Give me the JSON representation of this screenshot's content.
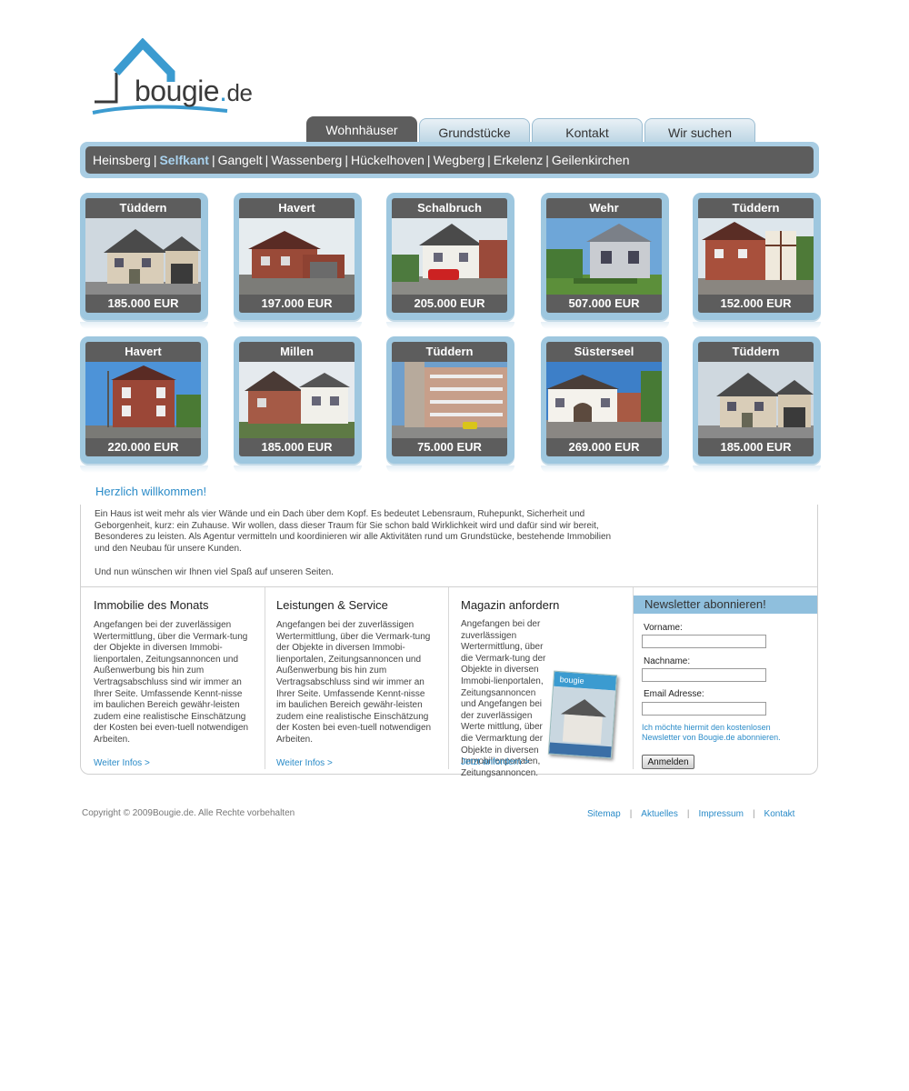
{
  "logo": {
    "brand": "bougie",
    "dot": ".",
    "tld": "de",
    "colors": {
      "roof": "#3b9bd0",
      "text": "#3a3a3a"
    }
  },
  "tabs": [
    {
      "label": "Wohnhäuser",
      "active": true
    },
    {
      "label": "Grundstücke",
      "active": false
    },
    {
      "label": "Kontakt",
      "active": false
    },
    {
      "label": "Wir suchen",
      "active": false
    }
  ],
  "cities": [
    {
      "label": "Heinsberg",
      "selected": false
    },
    {
      "label": "Selfkant",
      "selected": true
    },
    {
      "label": "Gangelt",
      "selected": false
    },
    {
      "label": "Wassenberg",
      "selected": false
    },
    {
      "label": "Hückelhoven",
      "selected": false
    },
    {
      "label": "Wegberg",
      "selected": false
    },
    {
      "label": "Erkelenz",
      "selected": false
    },
    {
      "label": "Geilenkirchen",
      "selected": false
    }
  ],
  "city_separator": "|",
  "properties": [
    {
      "title": "Tüddern",
      "price": "185.000 EUR",
      "photo": "house-gray-garage"
    },
    {
      "title": "Havert",
      "price": "197.000 EUR",
      "photo": "house-brick-garage"
    },
    {
      "title": "Schalbruch",
      "price": "205.000 EUR",
      "photo": "house-white-red-car"
    },
    {
      "title": "Wehr",
      "price": "507.000 EUR",
      "photo": "house-modern-gray"
    },
    {
      "title": "Tüddern",
      "price": "152.000 EUR",
      "photo": "house-brick-timber"
    },
    {
      "title": "Havert",
      "price": "220.000 EUR",
      "photo": "house-brick-tall"
    },
    {
      "title": "Millen",
      "price": "185.000 EUR",
      "photo": "house-brick-white"
    },
    {
      "title": "Tüddern",
      "price": "75.000 EUR",
      "photo": "apartment-block"
    },
    {
      "title": "Süsterseel",
      "price": "269.000 EUR",
      "photo": "farmhouse-white"
    },
    {
      "title": "Tüddern",
      "price": "185.000 EUR",
      "photo": "house-gray-garage"
    }
  ],
  "welcome": {
    "title": "Herzlich willkommen!",
    "text": "Ein Haus ist weit mehr als vier Wände und ein Dach über dem Kopf. Es bedeutet Lebensraum, Ruhepunkt, Sicherheit und Geborgenheit, kurz: ein Zuhause. Wir wollen, dass dieser Traum für Sie schon bald Wirklichkeit wird und dafür sind wir bereit, Besonderes zu leisten. Als Agentur vermitteln und koordinieren wir alle Aktivitäten rund um Grundstücke, bestehende Immobilien und den Neubau für unsere Kunden.",
    "closing": "Und nun wünschen wir Ihnen viel Spaß auf unseren Seiten."
  },
  "columns": [
    {
      "title": "Immobilie des Monats",
      "text": "Angefangen bei der zuverlässigen Wertermittlung, über die Vermark-tung der Objekte in diversen Immobi-lienportalen, Zeitungsannoncen und Außenwerbung bis hin zum Vertragsabschluss sind wir immer an Ihrer Seite. Umfassende Kennt-nisse im baulichen Bereich gewähr-leisten zudem eine realistische Einschätzung der Kosten bei even-tuell notwendigen Arbeiten.",
      "link": "Weiter Infos >"
    },
    {
      "title": "Leistungen & Service",
      "text": "Angefangen bei der zuverlässigen Wertermittlung, über die Vermark-tung der Objekte in diversen Immobi-lienportalen, Zeitungsannoncen und Außenwerbung bis hin zum Vertragsabschluss sind wir immer an Ihrer Seite. Umfassende Kennt-nisse im baulichen Bereich gewähr-leisten zudem eine realistische Einschätzung der Kosten bei even-tuell notwendigen Arbeiten.",
      "link": "Weiter Infos >"
    },
    {
      "title": "Magazin anfordern",
      "text": "Angefangen bei der zuverlässigen Wertermittlung, über die Vermark-tung der Objekte in diversen Immobi-lienportalen, Zeitungsannoncen und Angefangen bei der zuverlässigen Werte mittlung, über die Vermarktung der Objekte in diversen Immobilienportalen, Zeitungsannoncen.",
      "link": "Jetzt anfordern >",
      "magazine_brand": "bougie"
    }
  ],
  "newsletter": {
    "title": "Newsletter abonnieren!",
    "firstname_label": "Vorname:",
    "lastname_label": "Nachname:",
    "email_label": "Email Adresse:",
    "firstname_value": "",
    "lastname_value": "",
    "email_value": "",
    "note": "Ich möchte hiermit den kostenlosen Newsletter von Bougie.de abonnieren.",
    "button": "Anmelden"
  },
  "footer": {
    "copyright": "Copyright © 2009Bougie.de. Alle Rechte vorbehalten",
    "links": [
      "Sitemap",
      "Aktuelles",
      "Impressum",
      "Kontakt"
    ],
    "separator": "|"
  }
}
